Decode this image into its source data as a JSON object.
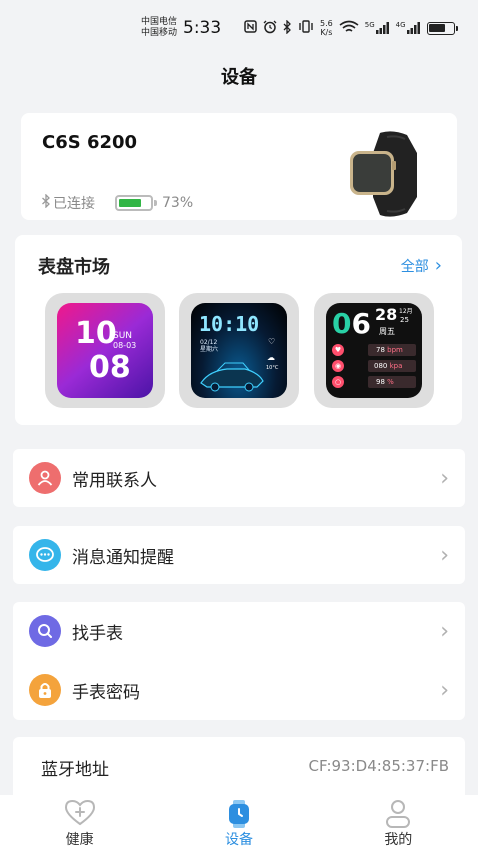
{
  "status_bar": {
    "carrier_1": "中国电信",
    "carrier_2": "中国移动",
    "time": "5:33",
    "speed_top": "5.6",
    "speed_bottom": "K/s",
    "signal_1": "5G",
    "signal_2": "4G",
    "icons": [
      "nfc-icon",
      "alarm-icon",
      "bluetooth-icon",
      "vibrate-icon",
      "wifi-icon",
      "signal-icon",
      "battery-icon"
    ]
  },
  "header": {
    "title": "设备"
  },
  "device": {
    "name": "C6S 6200",
    "connection": "已连接",
    "battery": "73%",
    "battery_level": 0.73,
    "battery_color": "#31b545"
  },
  "dial_market": {
    "title": "表盘市场",
    "all_label": "全部",
    "accent": "#2d8fe0",
    "faces": [
      {
        "hour": "10",
        "minute": "08",
        "day": "SUN",
        "date": "08-03"
      },
      {
        "time": "10:10",
        "date": "02/12",
        "weekday": "星期六",
        "temp": "10°C"
      },
      {
        "hour": "06",
        "minute": "28",
        "month": "12月",
        "day": "25",
        "weekday": "周五",
        "heart": "78",
        "heart_unit": "bpm",
        "pressure": "080",
        "pressure_unit": "kpa",
        "oxygen": "98",
        "oxygen_unit": "%"
      }
    ]
  },
  "menu": {
    "contacts": {
      "label": "常用联系人",
      "color": "#ee6e6e"
    },
    "notifications": {
      "label": "消息通知提醒",
      "color": "#35b5ea"
    },
    "find_watch": {
      "label": "找手表",
      "color": "#6f6ae4"
    },
    "watch_password": {
      "label": "手表密码",
      "color": "#f4a33c"
    }
  },
  "bluetooth": {
    "label": "蓝牙地址",
    "value": "CF:93:D4:85:37:FB"
  },
  "bottom_nav": {
    "items": [
      {
        "label": "健康"
      },
      {
        "label": "设备"
      },
      {
        "label": "我的"
      }
    ],
    "active_color": "#2d8fe0"
  }
}
